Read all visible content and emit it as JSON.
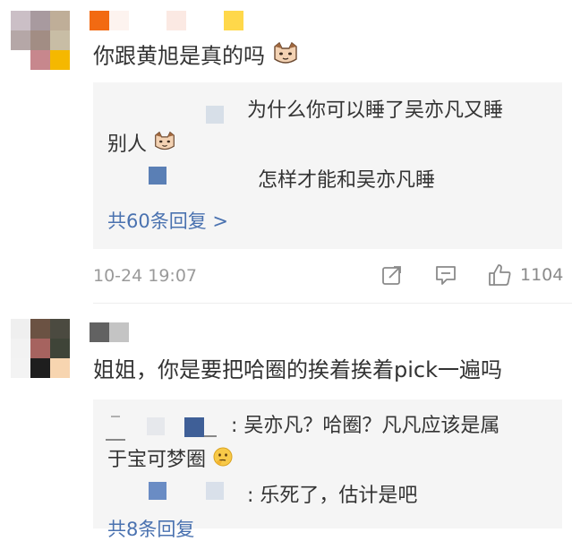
{
  "comments": [
    {
      "text": "你跟黄旭是真的吗",
      "emoji": "cat-face-emoji",
      "replies": [
        {
          "text_line1": "为什么你可以睡了吴亦凡又睡",
          "text_line2": "别人",
          "emoji": "cat-face-emoji"
        },
        {
          "text": "怎样才能和吴亦凡睡"
        }
      ],
      "more_replies_label": "共60条回复 >",
      "timestamp": "10-24 19:07",
      "like_count": "1104"
    },
    {
      "text": "姐姐，你是要把哈圈的挨着挨着pick一遍吗",
      "replies": [
        {
          "text_line1": ": 吴亦凡？哈圈？凡凡应该是属",
          "text_line2": "于宝可梦圈",
          "emoji": "thinking-face-emoji"
        },
        {
          "text": ": 乐死了，估计是吧"
        }
      ],
      "more_replies_label": "共8条回复"
    }
  ],
  "icons": {
    "share": "share-icon",
    "comment": "comment-icon",
    "like": "thumbs-up-icon"
  },
  "colors": {
    "link": "#4a72b0",
    "meta": "#9a9a9a",
    "reply_bg": "#f5f5f5"
  }
}
